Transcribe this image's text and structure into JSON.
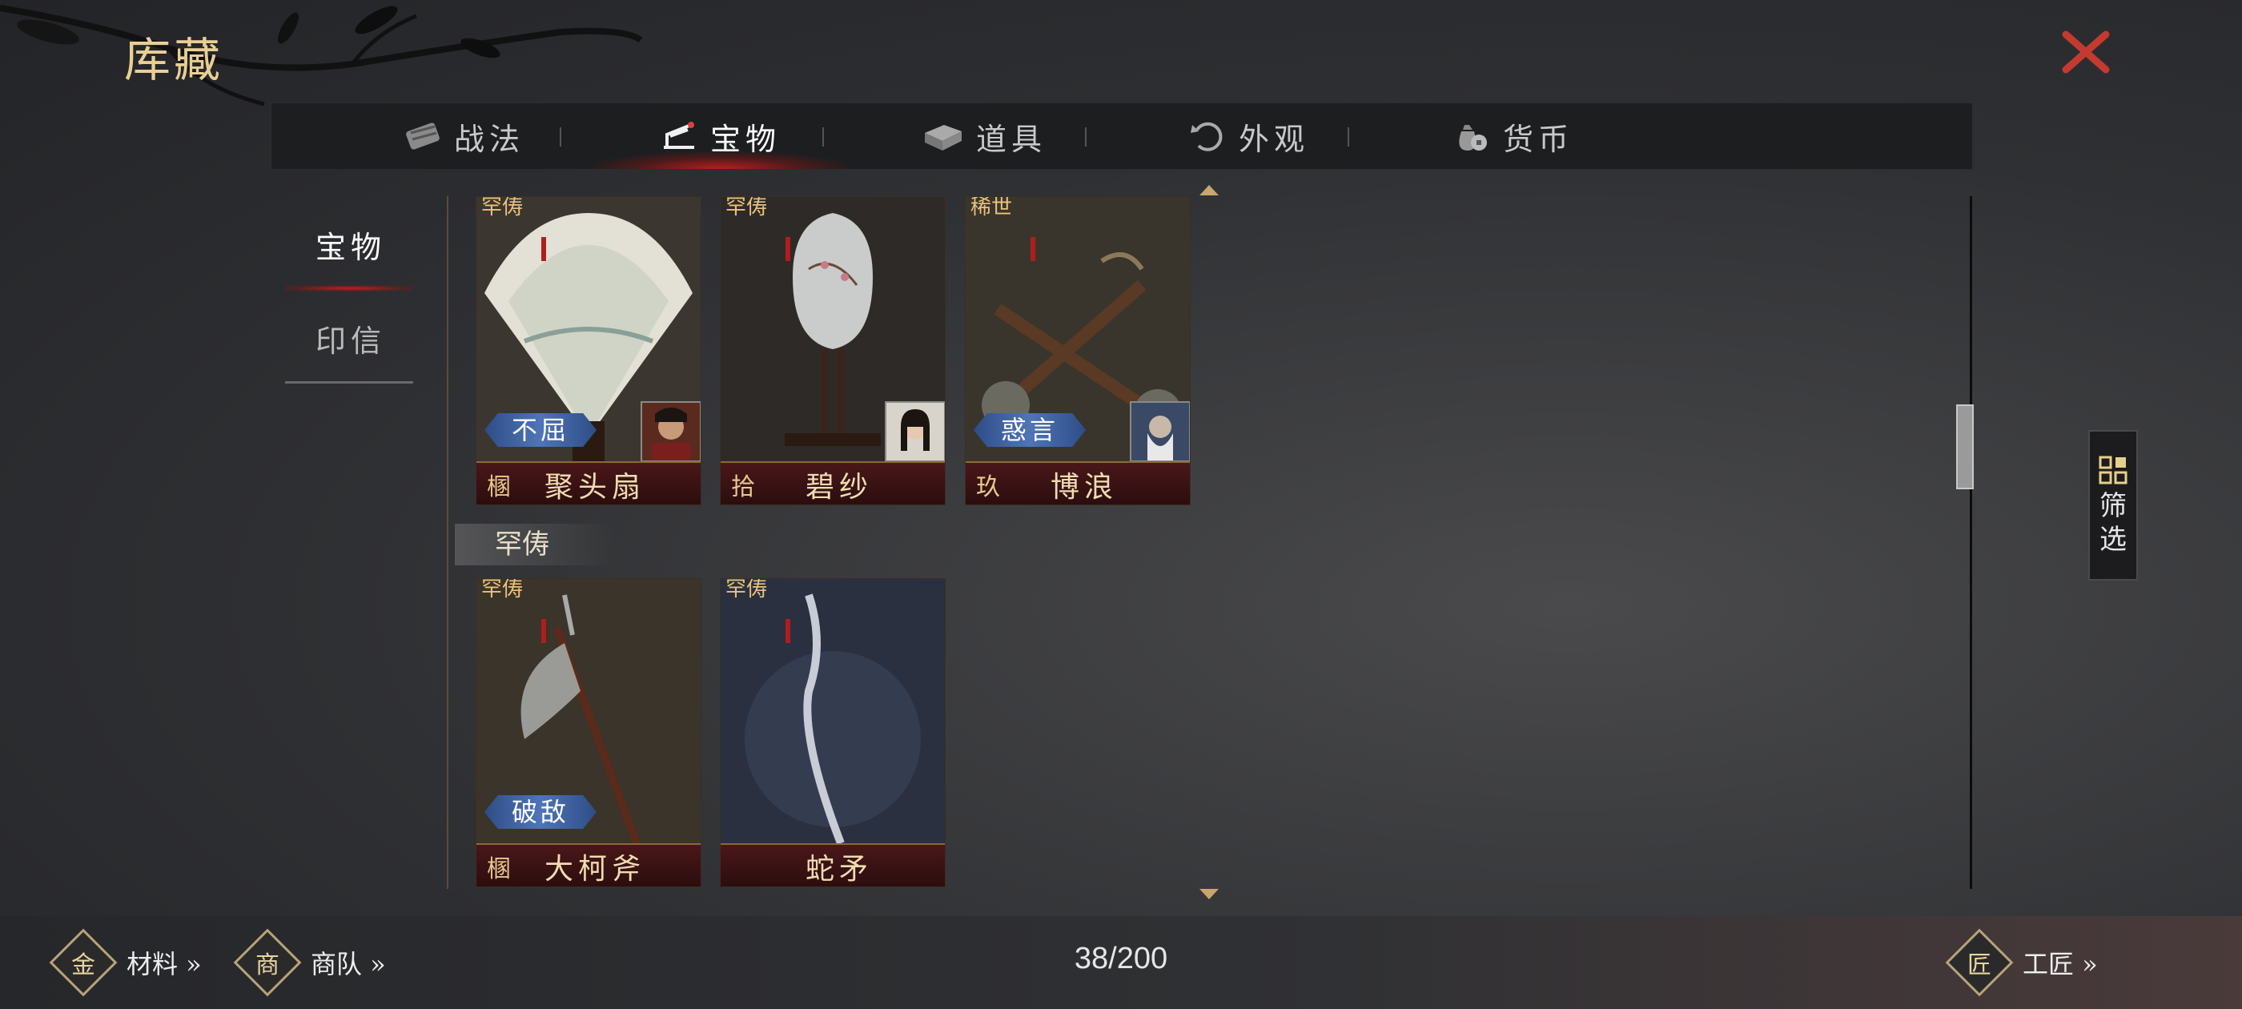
{
  "header": {
    "title": "库藏"
  },
  "tabs": [
    {
      "label": "战法",
      "icon": "scroll-icon",
      "active": false
    },
    {
      "label": "宝物",
      "icon": "treasure-icon",
      "active": true
    },
    {
      "label": "道具",
      "icon": "item-box-icon",
      "active": false
    },
    {
      "label": "外观",
      "icon": "appearance-icon",
      "active": false
    },
    {
      "label": "货币",
      "icon": "money-bag-icon",
      "active": false
    }
  ],
  "sidebar": [
    {
      "label": "宝物",
      "active": true
    },
    {
      "label": "印信",
      "active": false
    }
  ],
  "section_title": "罕俦",
  "cards_top": [
    {
      "rarity": "罕俦",
      "skill": "不屈",
      "grade": "㮯",
      "name": "聚头扇"
    },
    {
      "rarity": "罕俦",
      "skill": "",
      "grade": "拾",
      "name": "碧纱"
    },
    {
      "rarity": "稀世",
      "skill": "惑言",
      "grade": "玖",
      "name": "博浪"
    }
  ],
  "cards_bottom": [
    {
      "rarity": "罕俦",
      "skill": "破敌",
      "grade": "㮯",
      "name": "大柯斧"
    },
    {
      "rarity": "罕俦",
      "skill": "",
      "grade": "",
      "name": "蛇矛"
    }
  ],
  "filter": {
    "label": "筛选"
  },
  "bottom": {
    "materials": "材料 »",
    "materials_icon_glyph": "金",
    "caravan": "商队 »",
    "caravan_icon_glyph": "商",
    "craftsman": "工匠 »",
    "craftsman_icon_glyph": "匠",
    "count": "38/200"
  },
  "colors": {
    "accent_red": "#c81e1e",
    "gold": "#e9cf95",
    "skill_blue": "#4f75b8"
  }
}
